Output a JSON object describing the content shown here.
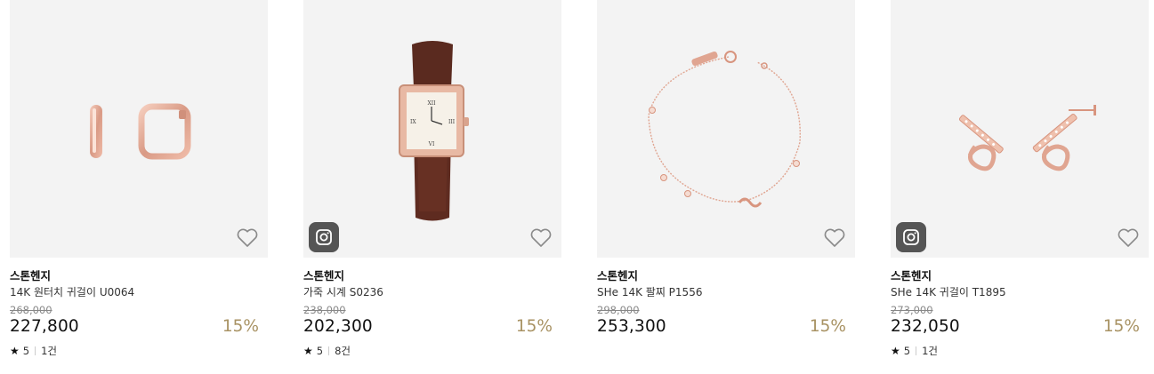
{
  "products": [
    {
      "brand": "스톤헨지",
      "name": "14K 원터치 귀걸이 U0064",
      "original_price": "268,000",
      "price": "227,800",
      "discount": "15%",
      "rating": "5",
      "review_count": "1건",
      "has_instagram": false,
      "heart_icon": "heart-outline-icon"
    },
    {
      "brand": "스톤헨지",
      "name": "가죽 시계 S0236",
      "original_price": "238,000",
      "price": "202,300",
      "discount": "15%",
      "rating": "5",
      "review_count": "8건",
      "has_instagram": true,
      "heart_icon": "heart-outline-icon"
    },
    {
      "brand": "스톤헨지",
      "name": "SHe 14K 팔찌 P1556",
      "original_price": "298,000",
      "price": "253,300",
      "discount": "15%",
      "rating": null,
      "review_count": null,
      "has_instagram": false,
      "heart_icon": "heart-outline-icon"
    },
    {
      "brand": "스톤헨지",
      "name": "SHe 14K 귀걸이 T1895",
      "original_price": "273,000",
      "price": "232,050",
      "discount": "15%",
      "rating": "5",
      "review_count": "1건",
      "has_instagram": true,
      "heart_icon": "heart-outline-icon"
    }
  ],
  "colors": {
    "discount": "#a89263",
    "thumb_bg": "#f3f3f3",
    "rose_gold": "#e0a591"
  }
}
